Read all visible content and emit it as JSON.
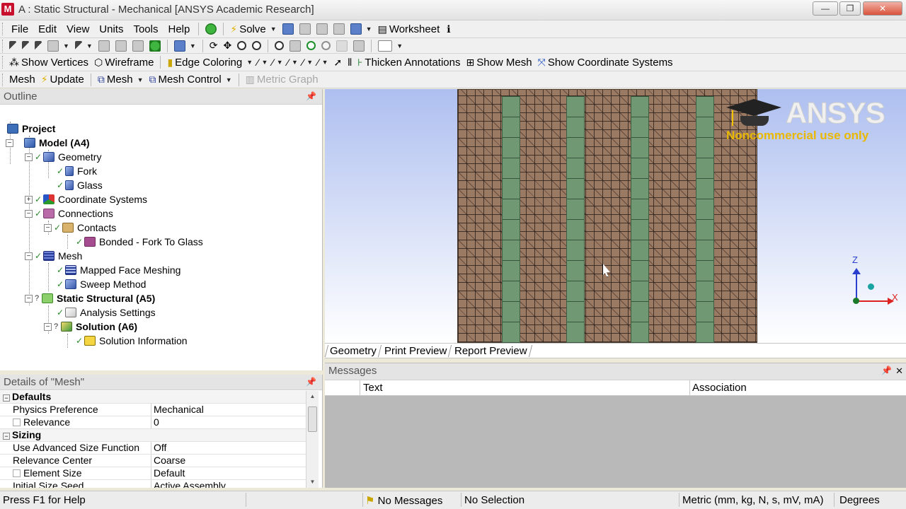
{
  "window": {
    "title": "A : Static Structural - Mechanical [ANSYS Academic Research]",
    "app_icon": "M"
  },
  "menu": [
    "File",
    "Edit",
    "View",
    "Units",
    "Tools",
    "Help"
  ],
  "toolbar1": {
    "solve": "Solve",
    "worksheet": "Worksheet"
  },
  "toolbar3": {
    "show_vertices": "Show Vertices",
    "wireframe": "Wireframe",
    "edge_coloring": "Edge Coloring",
    "thicken_annotations": "Thicken Annotations",
    "show_mesh": "Show Mesh",
    "show_coordinate_systems": "Show Coordinate Systems"
  },
  "toolbar4": {
    "context": "Mesh",
    "update": "Update",
    "mesh": "Mesh",
    "mesh_control": "Mesh Control",
    "metric_graph": "Metric Graph"
  },
  "outline": {
    "title": "Outline",
    "nodes": [
      {
        "label": "Project"
      },
      {
        "label": "Model (A4)"
      },
      {
        "label": "Geometry"
      },
      {
        "label": "Fork"
      },
      {
        "label": "Glass"
      },
      {
        "label": "Coordinate Systems"
      },
      {
        "label": "Connections"
      },
      {
        "label": "Contacts"
      },
      {
        "label": "Bonded - Fork To Glass"
      },
      {
        "label": "Mesh"
      },
      {
        "label": "Mapped Face Meshing"
      },
      {
        "label": "Sweep Method"
      },
      {
        "label": "Static Structural (A5)"
      },
      {
        "label": "Analysis Settings"
      },
      {
        "label": "Solution (A6)"
      },
      {
        "label": "Solution Information"
      }
    ]
  },
  "details": {
    "title": "Details of \"Mesh\"",
    "rows": [
      {
        "key": "Defaults",
        "value": ""
      },
      {
        "key": "Physics Preference",
        "value": "Mechanical"
      },
      {
        "key": "Relevance",
        "value": "0"
      },
      {
        "key": "Sizing",
        "value": ""
      },
      {
        "key": "Use Advanced Size Function",
        "value": "Off"
      },
      {
        "key": "Relevance Center",
        "value": "Coarse"
      },
      {
        "key": "Element Size",
        "value": "Default"
      },
      {
        "key": "Initial Size Seed",
        "value": "Active Assembly"
      }
    ]
  },
  "viewport": {
    "logo_text": "ANSYS",
    "logo_sub": "Noncommercial use only",
    "axis_z": "Z",
    "axis_x": "X"
  },
  "view_tabs": [
    "Geometry",
    "Print Preview",
    "Report Preview"
  ],
  "messages": {
    "title": "Messages",
    "col_text": "Text",
    "col_association": "Association"
  },
  "status": {
    "help": "Press F1 for Help",
    "messages": "No Messages",
    "selection": "No Selection",
    "units": "Metric (mm, kg, N, s, mV, mA)",
    "angle": "Degrees"
  },
  "colors": {
    "mesh_body": "#9b7a64",
    "tines": "#6f9873",
    "viewport_top": "#aebff0",
    "logo_sub": "#e9b800"
  }
}
